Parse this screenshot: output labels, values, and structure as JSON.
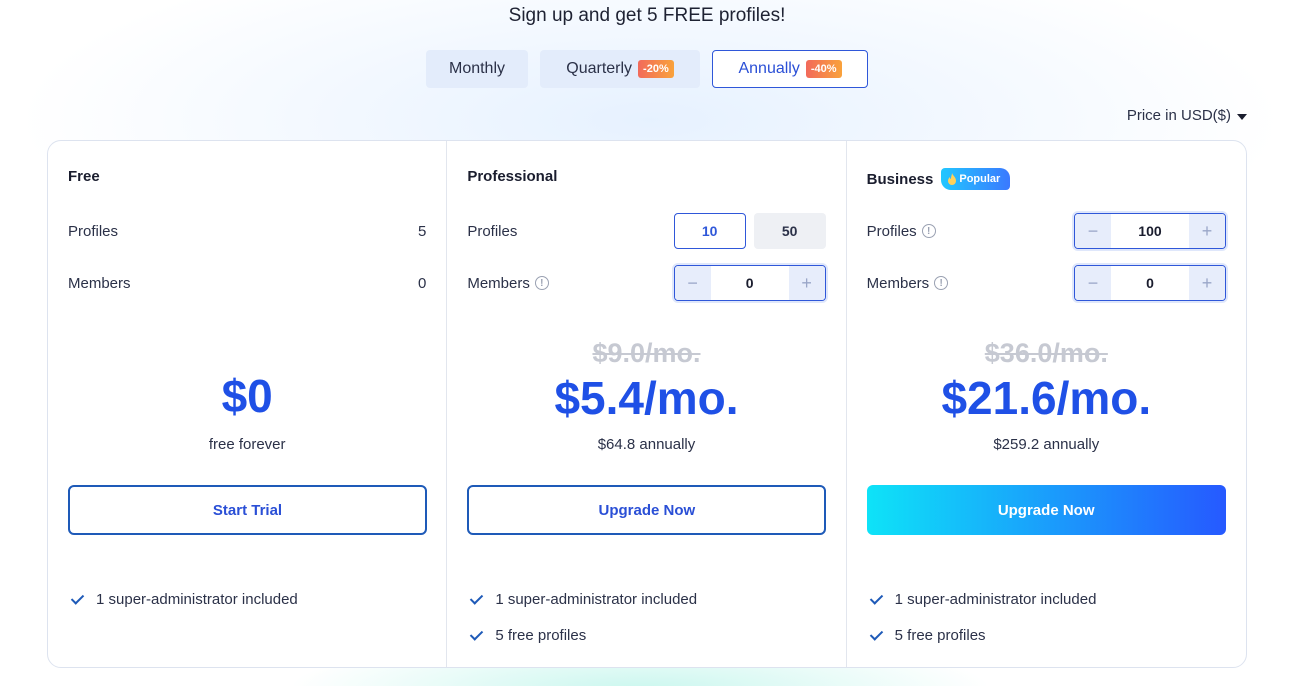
{
  "headline": "Sign up and get 5 FREE profiles!",
  "billing": {
    "monthly": "Monthly",
    "quarterly": "Quarterly",
    "quarterly_discount": "-20%",
    "annually": "Annually",
    "annually_discount": "-40%",
    "selected": "Annually"
  },
  "currency": "Price in USD($)",
  "colors": {
    "accent": "#1f50e6",
    "border_selected": "#2f57d9",
    "discount_start": "#f26a5b",
    "discount_end": "#f9a23b",
    "cta_start": "#0ee3f8",
    "cta_end": "#2659ff"
  },
  "plans": {
    "free": {
      "name": "Free",
      "profiles_label": "Profiles",
      "profiles_value": "5",
      "members_label": "Members",
      "members_value": "0",
      "price": "$0",
      "price_sub": "free forever",
      "cta": "Start Trial",
      "features": [
        "1 super-administrator included"
      ]
    },
    "professional": {
      "name": "Professional",
      "profiles_label": "Profiles",
      "profile_options": [
        "10",
        "50"
      ],
      "profile_selected": "10",
      "members_label": "Members",
      "members_value": "0",
      "old_price": "$9.0/mo.",
      "price": "$5.4/mo.",
      "price_sub": "$64.8 annually",
      "cta": "Upgrade Now",
      "features": [
        "1 super-administrator included",
        "5 free profiles"
      ]
    },
    "business": {
      "name": "Business",
      "badge": "Popular",
      "profiles_label": "Profiles",
      "profiles_value": "100",
      "members_label": "Members",
      "members_value": "0",
      "old_price": "$36.0/mo.",
      "price": "$21.6/mo.",
      "price_sub": "$259.2 annually",
      "cta": "Upgrade Now",
      "features": [
        "1 super-administrator included",
        "5 free profiles"
      ]
    }
  },
  "stepper": {
    "minus": "−",
    "plus": "+"
  },
  "icons": {
    "info": "info-icon",
    "check": "check-icon",
    "caret": "caret-down-icon",
    "fire": "fire-icon"
  }
}
